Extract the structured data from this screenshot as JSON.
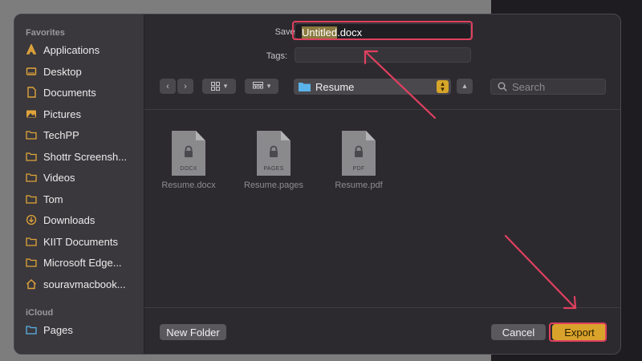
{
  "sidebar": {
    "favorites_heading": "Favorites",
    "icloud_heading": "iCloud",
    "items": [
      {
        "label": "Applications",
        "icon": "applications-icon"
      },
      {
        "label": "Desktop",
        "icon": "desktop-icon"
      },
      {
        "label": "Documents",
        "icon": "documents-icon"
      },
      {
        "label": "Pictures",
        "icon": "pictures-icon"
      },
      {
        "label": "TechPP",
        "icon": "folder-icon"
      },
      {
        "label": "Shottr Screensh...",
        "icon": "folder-icon"
      },
      {
        "label": "Videos",
        "icon": "folder-icon"
      },
      {
        "label": "Tom",
        "icon": "folder-icon"
      },
      {
        "label": "Downloads",
        "icon": "downloads-icon"
      },
      {
        "label": "KIIT Documents",
        "icon": "folder-icon"
      },
      {
        "label": "Microsoft Edge...",
        "icon": "folder-icon"
      },
      {
        "label": "souravmacbook...",
        "icon": "home-icon"
      }
    ],
    "icloud_items": [
      {
        "label": "Pages",
        "icon": "folder-icon"
      }
    ]
  },
  "save_as": {
    "label": "Save As:",
    "highlighted": "Untitled",
    "suffix": ".docx"
  },
  "tags": {
    "label": "Tags:",
    "value": ""
  },
  "toolbar": {
    "location": "Resume",
    "search_placeholder": "Search"
  },
  "files": [
    {
      "name": "Resume.docx",
      "type": "DOCX"
    },
    {
      "name": "Resume.pages",
      "type": "PAGES"
    },
    {
      "name": "Resume.pdf",
      "type": "PDF"
    }
  ],
  "footer": {
    "new_folder": "New Folder",
    "cancel": "Cancel",
    "export": "Export"
  },
  "colors": {
    "accent": "#d9a32b",
    "annotation": "#e0405f",
    "folder": "#e0a43a",
    "icloud_folder": "#5ab4ea"
  }
}
